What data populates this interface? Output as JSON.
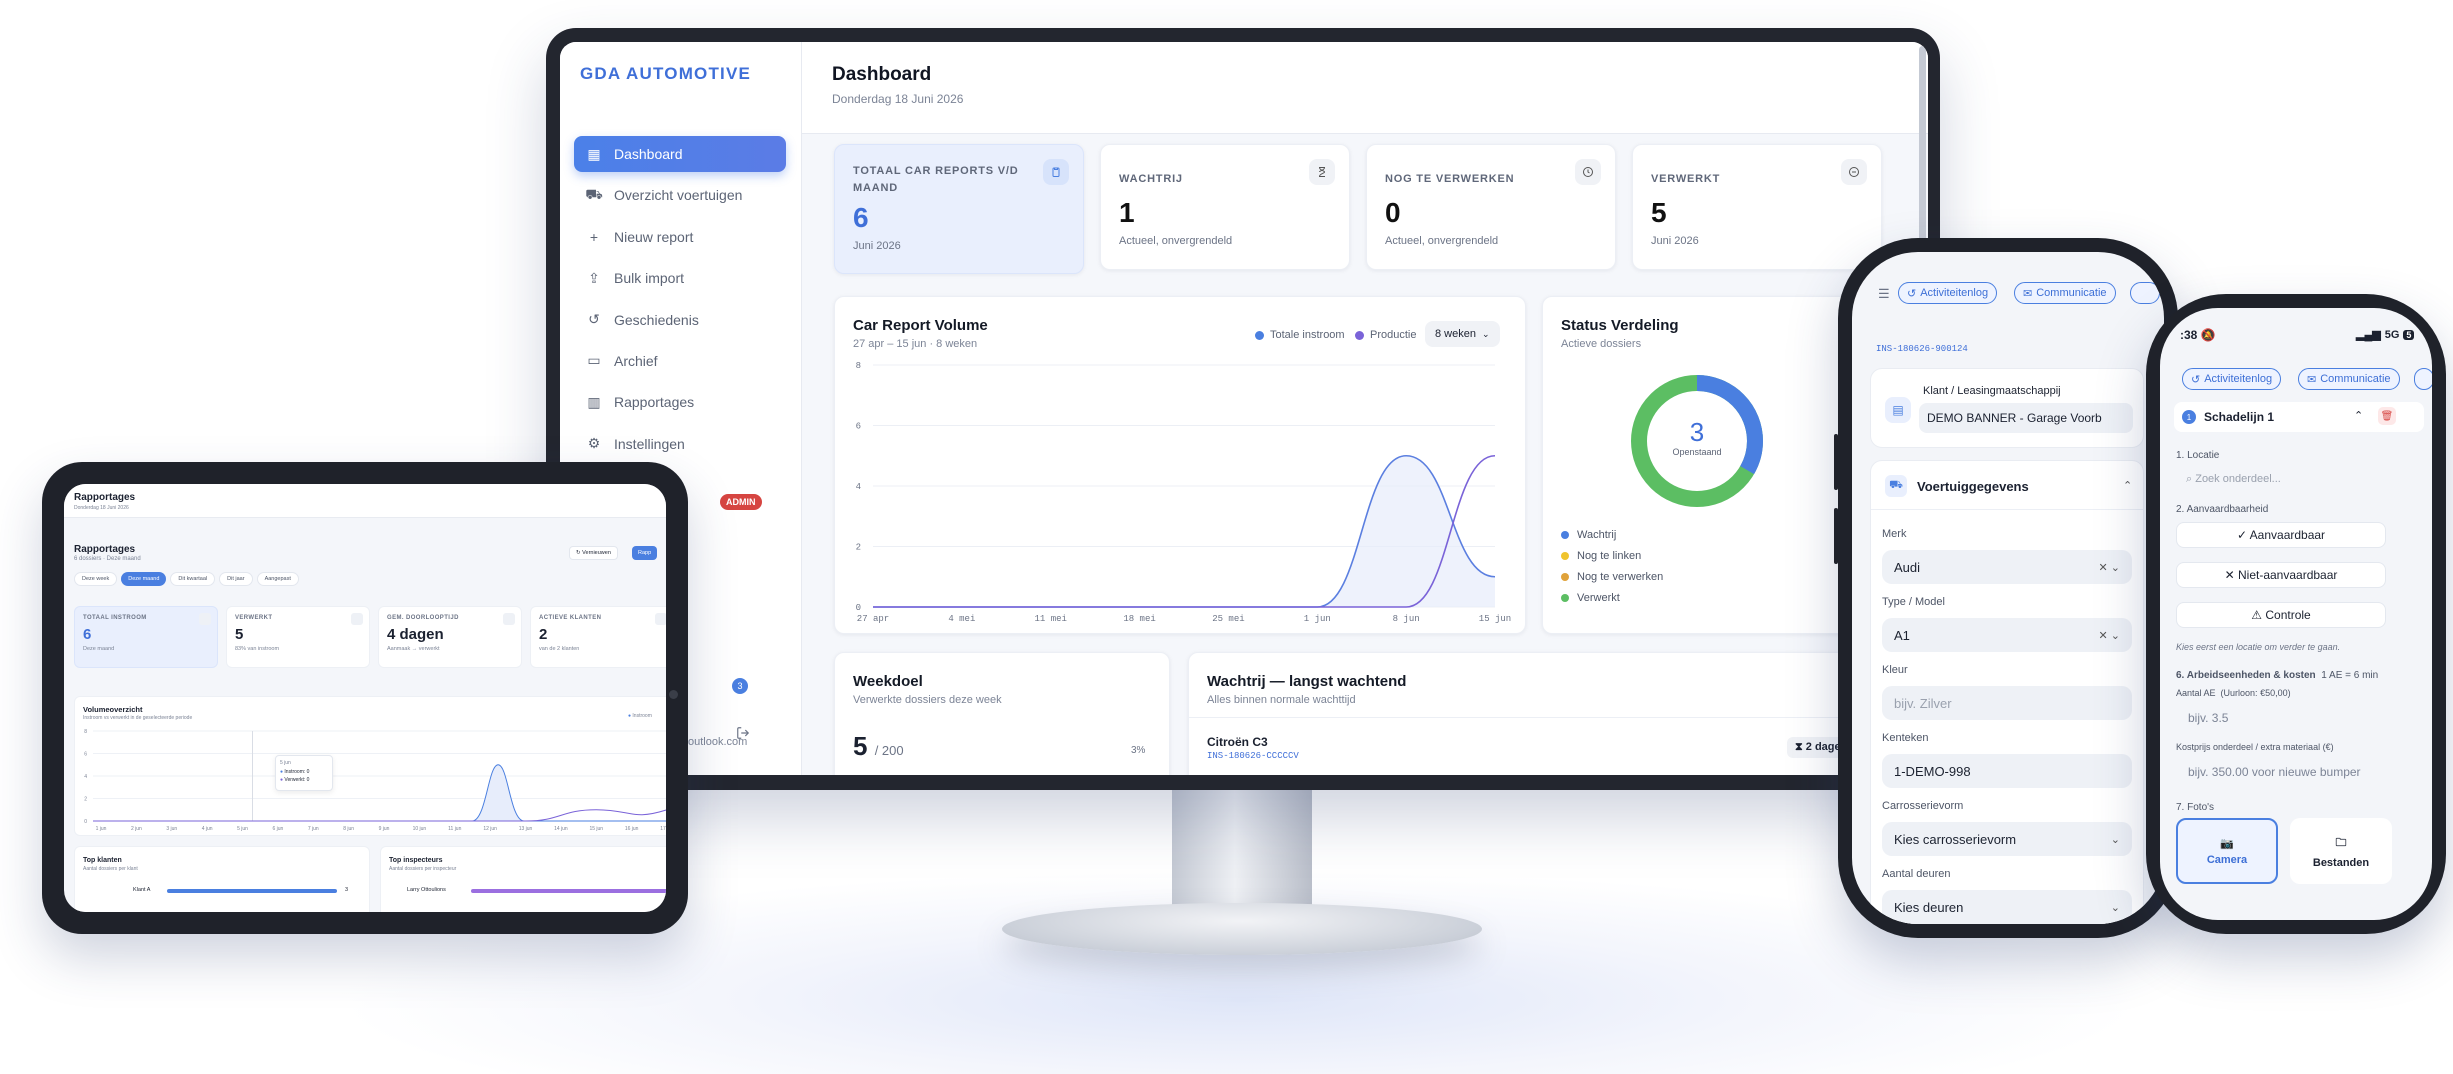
{
  "monitor": {
    "brand": "GDA AUTOMOTIVE",
    "nav": [
      {
        "label": "Dashboard",
        "icon": "grid-icon"
      },
      {
        "label": "Overzicht voertuigen",
        "icon": "car-icon"
      },
      {
        "label": "Nieuw report",
        "icon": "plus-icon"
      },
      {
        "label": "Bulk import",
        "icon": "upload-icon"
      },
      {
        "label": "Geschiedenis",
        "icon": "history-icon"
      },
      {
        "label": "Archief",
        "icon": "archive-icon"
      },
      {
        "label": "Rapportages",
        "icon": "bar-chart-icon"
      },
      {
        "label": "Instellingen",
        "icon": "gear-icon"
      }
    ],
    "admin_badge": "ADMIN",
    "user_email_partial": "outlook.com",
    "notif_count": "3",
    "page_title": "Dashboard",
    "page_date": "Donderdag 18 Juni 2026",
    "kpis": [
      {
        "label": "TOTAAL CAR REPORTS V/D MAAND",
        "value": "6",
        "sub": "Juni 2026"
      },
      {
        "label": "WACHTRIJ",
        "value": "1",
        "sub": "Actueel, onvergrendeld"
      },
      {
        "label": "NOG TE VERWERKEN",
        "value": "0",
        "sub": "Actueel, onvergrendeld"
      },
      {
        "label": "VERWERKT",
        "value": "5",
        "sub": "Juni 2026"
      }
    ],
    "volume": {
      "title": "Car Report Volume",
      "sub": "27 apr – 15 jun · 8 weken",
      "legend_in": "Totale instroom",
      "legend_prod": "Productie",
      "range": "8 weken"
    },
    "status": {
      "title": "Status Verdeling",
      "sub": "Actieve dossiers",
      "center_value": "3",
      "center_label": "Openstaand",
      "legend": [
        {
          "label": "Wachtrij",
          "color": "#4a7fe0"
        },
        {
          "label": "Nog te linken",
          "color": "#f0c42e"
        },
        {
          "label": "Nog te verwerken",
          "color": "#e0a23a"
        },
        {
          "label": "Verwerkt",
          "color": "#5cbe63"
        }
      ]
    },
    "weekdoel": {
      "title": "Weekdoel",
      "sub": "Verwerkte dossiers deze week",
      "value": "5",
      "total": "/ 200",
      "pct": "3%"
    },
    "wachtrij": {
      "title": "Wachtrij — langst wachtend",
      "sub": "Alles binnen normale wachttijd",
      "car": "Citroën C3",
      "id": "INS-180626-CCCCCV",
      "wait": "2 dagen"
    }
  },
  "chart_data": {
    "type": "line",
    "categories": [
      "27 apr",
      "4 mei",
      "11 mei",
      "18 mei",
      "25 mei",
      "1 jun",
      "8 jun",
      "15 jun"
    ],
    "series": [
      {
        "name": "Totale instroom",
        "values": [
          0,
          0,
          0,
          0,
          0,
          0,
          5,
          1
        ],
        "color": "#5b7fe0"
      },
      {
        "name": "Productie",
        "values": [
          0,
          0,
          0,
          0,
          0,
          0,
          0,
          5
        ],
        "color": "#7a63d8"
      }
    ],
    "ylim": [
      0,
      8
    ],
    "yticks": [
      "0",
      "2",
      "4",
      "6",
      "8"
    ],
    "grid": true,
    "legend": "top-right"
  },
  "donut": {
    "wachtrij": 1,
    "verwerkt": 2
  },
  "tablet": {
    "top_title": "Rapportages",
    "top_date": "Donderdag 18 Juni 2026",
    "title": "Rapportages",
    "sub": "6 dossiers · Deze maand",
    "btn_vernieuwen": "Vernieuwen",
    "btn_export": "Rapp",
    "tabs": [
      "Deze week",
      "Deze maand",
      "Dit kwartaal",
      "Dit jaar",
      "Aangepast"
    ],
    "kpis": [
      {
        "label": "TOTAAL INSTROOM",
        "value": "6",
        "sub": "Deze maand"
      },
      {
        "label": "VERWERKT",
        "value": "5",
        "sub": "83% van instroom"
      },
      {
        "label": "GEM. DOORLOOPTIJD",
        "value": "4 dagen",
        "sub": "Aanmaak → verwerkt"
      },
      {
        "label": "ACTIEVE KLANTEN",
        "value": "2",
        "sub": "van de 2 klanten"
      }
    ],
    "vol_title": "Volumeoverzicht",
    "vol_sub": "Instroom vs verwerkt in de geselecteerde periode",
    "legend": [
      "Instroom"
    ],
    "yticks": [
      "0",
      "2",
      "4",
      "6",
      "8"
    ],
    "xticks": [
      "1 jun",
      "2 jun",
      "3 jun",
      "4 jun",
      "5 jun",
      "6 jun",
      "7 jun",
      "8 jun",
      "9 jun",
      "10 jun",
      "11 jun",
      "12 jun",
      "13 jun",
      "14 jun",
      "15 jun",
      "16 jun",
      "17 jun"
    ],
    "tooltip": {
      "date": "5 jun",
      "instroom": "Instroom: 0",
      "verwerkt": "Verwerkt: 0"
    },
    "top_klanten": "Top klanten",
    "top_klanten_sub": "Aantal dossiers per klant",
    "klant_row": "Klant A",
    "klant_val": "3",
    "top_insp": "Top inspecteurs",
    "top_insp_sub": "Aantal dossiers per inspecteur",
    "insp_row": "Larry Ottoulions"
  },
  "phone1": {
    "btn_activiteit": "Activiteitenlog",
    "btn_communicatie": "Communicatie",
    "dossier_id": "INS-180626-900124",
    "klant_label": "Klant / Leasingmaatschappij",
    "klant_value": "DEMO BANNER - Garage Voorb",
    "section": "Voertuiggegevens",
    "merk_label": "Merk",
    "merk": "Audi",
    "type_label": "Type / Model",
    "type": "A1",
    "kleur_label": "Kleur",
    "kleur_ph": "bijv. Zilver",
    "kenteken_label": "Kenteken",
    "kenteken": "1-DEMO-998",
    "carros_label": "Carrosserievorm",
    "carros": "Kies carrosserievorm",
    "deuren_label": "Aantal deuren",
    "deuren": "Kies deuren"
  },
  "phone2": {
    "time": ":38",
    "signal": "5G",
    "battery": "5",
    "btn_activiteit": "Activiteitenlog",
    "btn_communicatie": "Communicatie",
    "schade_num": "1",
    "schade_title": "Schadelijn 1",
    "locatie_label": "1. Locatie",
    "zoek_ph": "Zoek onderdeel...",
    "aanv_label": "2. Aanvaardbaarheid",
    "btn_aanv": "✓ Aanvaardbaar",
    "btn_niet": "✕ Niet-aanvaardbaar",
    "btn_controle": "⚠ Controle",
    "hint": "Kies eerst een locatie om verder te gaan.",
    "arbeid_label": "6. Arbeidseenheden & kosten",
    "arbeid_meta": "1 AE = 6 min",
    "ae_label": "Aantal AE",
    "ae_rate": "(Uurloon: €50,00)",
    "ae_ph": "bijv. 3.5",
    "kost_label": "Kostprijs onderdeel / extra materiaal (€)",
    "kost_ph": "bijv. 350.00 voor nieuwe bumper",
    "foto_label": "7. Foto's",
    "camera": "Camera",
    "bestanden": "Bestanden"
  }
}
